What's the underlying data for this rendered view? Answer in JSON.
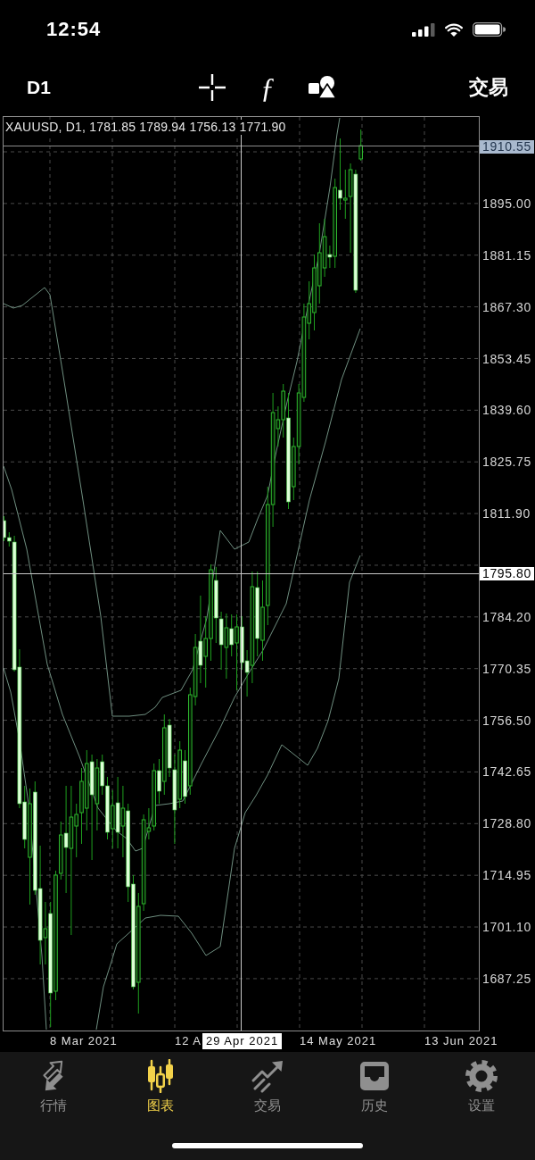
{
  "status_bar": {
    "time": "12:54"
  },
  "toolbar": {
    "timeframe": "D1",
    "indicators_symbol": "ƒ",
    "trade_button": "交易"
  },
  "chart": {
    "info": "XAUUSD, D1, 1781.85 1789.94 1756.13 1771.90",
    "current_price": "1910.55",
    "price_axis": [
      "1895.00",
      "1881.15",
      "1867.30",
      "1853.45",
      "1839.60",
      "1825.75",
      "1811.90",
      "1784.20",
      "1770.35",
      "1756.50",
      "1742.65",
      "1728.80",
      "1714.95",
      "1701.10",
      "1687.25"
    ],
    "date_axis": [
      "8 Mar 2021",
      "12 A",
      "14 May 2021",
      "13 Jun 2021"
    ],
    "crosshair": {
      "price": "1795.80",
      "date": "29 Apr 2021"
    }
  },
  "tab_bar": {
    "tabs": [
      {
        "label": "行情",
        "kind": "quotes",
        "selected": false
      },
      {
        "label": "图表",
        "kind": "chart",
        "selected": true
      },
      {
        "label": "交易",
        "kind": "trade",
        "selected": false
      },
      {
        "label": "历史",
        "kind": "history",
        "selected": false
      },
      {
        "label": "设置",
        "kind": "settings",
        "selected": false
      }
    ]
  }
}
